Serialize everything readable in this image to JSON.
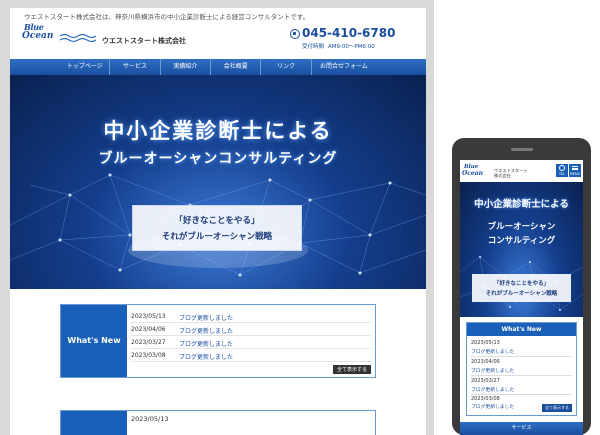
{
  "desktop": {
    "tagline": "ウエストスタート株式会社は、神奈川県横浜市の中小企業診断士による経営コンサルタントです。",
    "logo_line1": "Blue",
    "logo_line2": "Ocean",
    "company_name": "ウエストスタート株式会社",
    "phone_number": "045-410-6780",
    "hours_label": "受付時間",
    "hours": "AM9:00〜PM6:00",
    "nav": [
      {
        "label": "トップページ"
      },
      {
        "label": "サービス"
      },
      {
        "label": "実績紹介"
      },
      {
        "label": "会社概要"
      },
      {
        "label": "リンク"
      },
      {
        "label": "お問合せフォーム"
      }
    ],
    "hero": {
      "title1": "中小企業診断士による",
      "title2": "ブルーオーシャンコンサルティング",
      "box_line1": "「好きなことをやる」",
      "box_line2": "それがブルーオーシャン戦略"
    },
    "news": {
      "heading": "What's New",
      "items": [
        {
          "date": "2023/05/13",
          "text": "ブログ更新しました"
        },
        {
          "date": "2023/04/06",
          "text": "ブログ更新しました"
        },
        {
          "date": "2023/03/27",
          "text": "ブログ更新しました"
        },
        {
          "date": "2023/03/08",
          "text": "ブログ更新しました"
        }
      ],
      "more": "全て表示する"
    },
    "news2_date": "2023/05/13"
  },
  "mobile": {
    "logo_line1": "Blue",
    "logo_line2": "Ocean",
    "company_line1": "ウエストスタート",
    "company_line2": "株式会社",
    "tel_label": "TEL",
    "menu_label": "MENU",
    "hero": {
      "title1": "中小企業診断士による",
      "title2": "ブルーオーシャン",
      "title3": "コンサルティング",
      "box_line1": "「好きなことをやる」",
      "box_line2": "それがブルーオーシャン戦略"
    },
    "news": {
      "heading": "What's New",
      "items": [
        {
          "date": "2023/05/13",
          "text": "ブログ更新しました"
        },
        {
          "date": "2023/04/06",
          "text": "ブログ更新しました"
        },
        {
          "date": "2023/03/27",
          "text": "ブログ更新しました"
        },
        {
          "date": "2023/03/08",
          "text": "ブログ更新しました"
        }
      ],
      "more": "全て表示する"
    },
    "footer_label": "サービス"
  },
  "colors": {
    "brand_blue": "#1a4fa0",
    "accent_blue": "#1a5fb8",
    "hero_dark": "#0a2150"
  }
}
